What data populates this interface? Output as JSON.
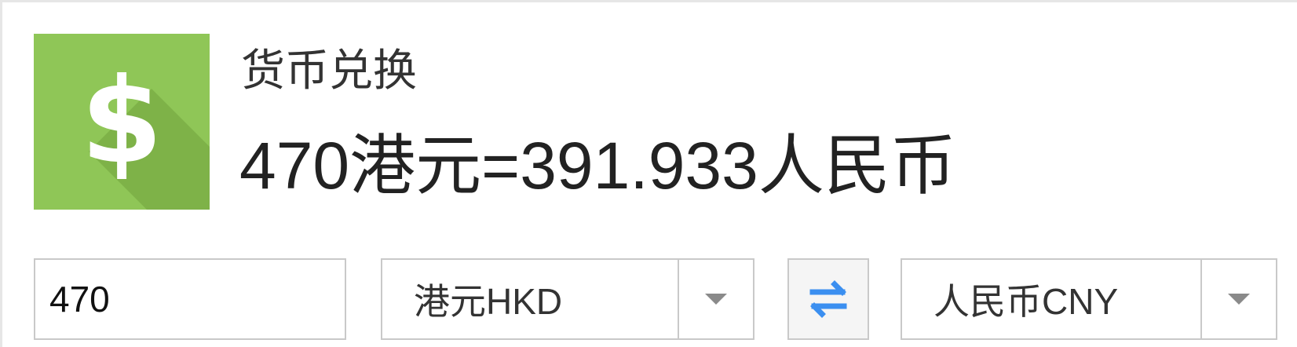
{
  "widget": {
    "logo_icon": "dollar-sign-icon",
    "logo_symbol": "$",
    "title": "货币兑换",
    "result": "470港元=391.933人民币",
    "colors": {
      "logo_bg": "#8fc657",
      "swap_icon": "#3b8ff0",
      "border": "#c9c9c9"
    }
  },
  "converter": {
    "amount": "470",
    "from_currency": "港元HKD",
    "to_currency": "人民币CNY",
    "swap_icon": "swap-arrows-icon",
    "dropdown_icon": "caret-down-icon"
  }
}
